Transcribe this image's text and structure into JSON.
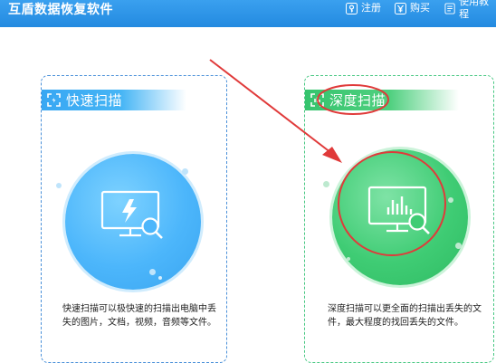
{
  "app": {
    "title": "互盾数据恢复软件"
  },
  "titlebar": {
    "register_label": "注册",
    "buy_label": "购买",
    "tutorial_label": "使用教程"
  },
  "cards": {
    "quick": {
      "title": "快速扫描",
      "description": "快速扫描可以极快速的扫描出电脑中丢失的图片，文档，视频，音频等文件。",
      "color": "#38a7f3"
    },
    "deep": {
      "title": "深度扫描",
      "description": "深度扫描可以更全面的扫描出丢失的文件，最大程度的找回丢失的文件。",
      "color": "#36c46e"
    }
  },
  "annotation": {
    "color": "#e03a3a"
  }
}
